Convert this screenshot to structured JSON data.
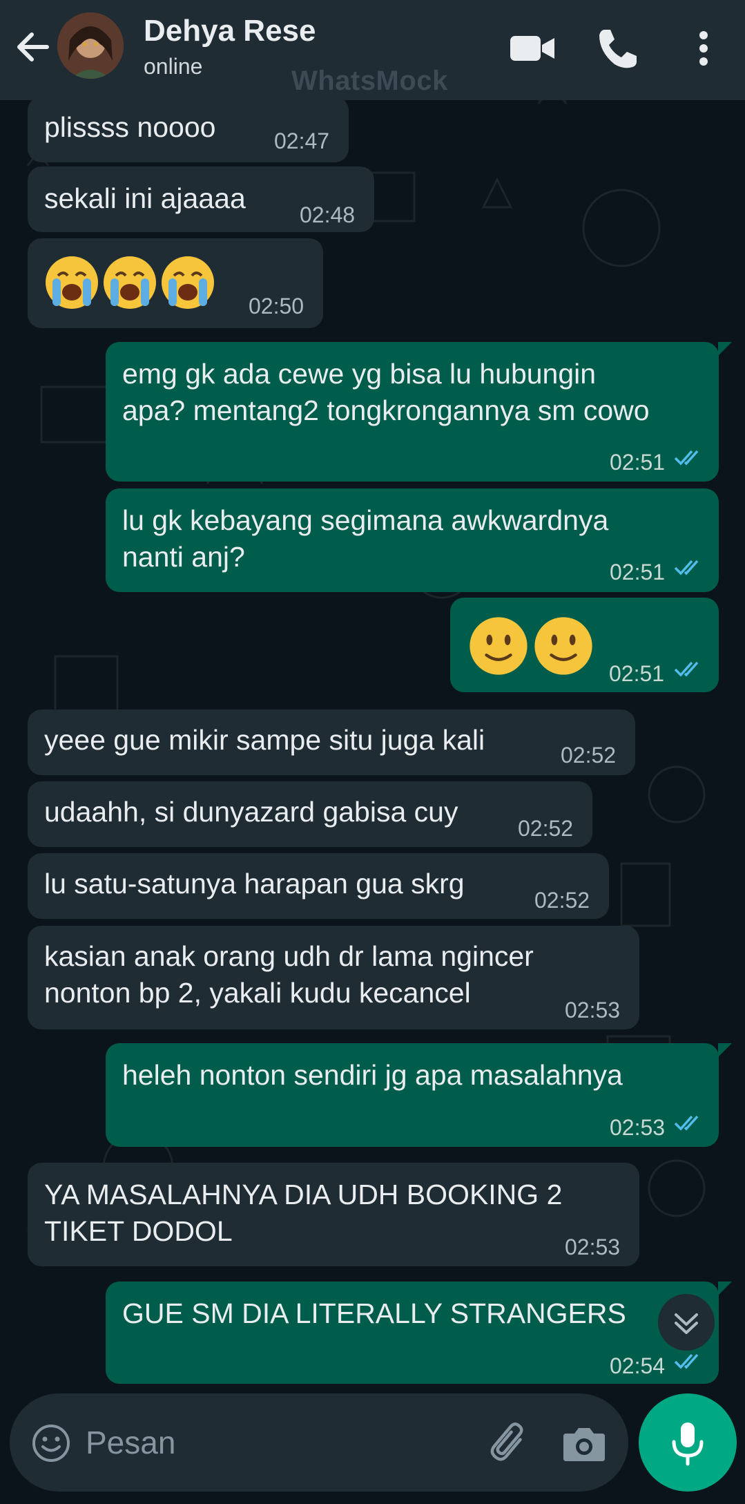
{
  "header": {
    "name": "Dehya Rese",
    "status": "online",
    "watermark": "WhatsMock"
  },
  "messages": [
    {
      "dir": "in",
      "text": "plissss noooo",
      "time": "02:47"
    },
    {
      "dir": "in",
      "text": "sekali ini ajaaaa",
      "time": "02:48"
    },
    {
      "dir": "in",
      "emoji": [
        "loudly-crying-face",
        "loudly-crying-face",
        "loudly-crying-face"
      ],
      "time": "02:50"
    },
    {
      "dir": "out",
      "text": "emg gk ada cewe yg bisa lu hubungin\napa? mentang2 tongkrongannya sm cowo",
      "time": "02:51",
      "status": "read"
    },
    {
      "dir": "out",
      "text": "lu gk kebayang segimana awkwardnya\nnanti anj?",
      "time": "02:51",
      "status": "read"
    },
    {
      "dir": "out",
      "emoji": [
        "slightly-smiling-face",
        "slightly-smiling-face"
      ],
      "time": "02:51",
      "status": "read"
    },
    {
      "dir": "in",
      "text": "yeee gue mikir sampe situ juga kali",
      "time": "02:52"
    },
    {
      "dir": "in",
      "text": "udaahh, si dunyazard gabisa cuy",
      "time": "02:52"
    },
    {
      "dir": "in",
      "text": "lu satu-satunya harapan gua skrg",
      "time": "02:52"
    },
    {
      "dir": "in",
      "text": "kasian anak orang udh dr lama ngincer\nnonton bp 2, yakali kudu kecancel",
      "time": "02:53"
    },
    {
      "dir": "out",
      "text": "heleh nonton sendiri jg apa masalahnya",
      "time": "02:53",
      "status": "read"
    },
    {
      "dir": "in",
      "text": "YA MASALAHNYA DIA UDH BOOKING 2\nTIKET DODOL",
      "time": "02:53"
    },
    {
      "dir": "out",
      "text": "GUE SM DIA LITERALLY STRANGERS",
      "time": "02:54",
      "status": "read"
    }
  ],
  "composer": {
    "placeholder": "Pesan"
  },
  "colors": {
    "header_bg": "#1f2c34",
    "chat_bg": "#0b141a",
    "incoming_bubble": "#1f2c34",
    "outgoing_bubble": "#005c4b",
    "read_tick": "#53bdeb",
    "accent": "#00a884"
  },
  "icons": {
    "back": "arrow-left-icon",
    "video": "video-call-icon",
    "call": "phone-icon",
    "menu": "more-vertical-icon",
    "emoji": "emoji-smile-icon",
    "attach": "paperclip-icon",
    "camera": "camera-icon",
    "mic": "microphone-icon",
    "scroll": "chevron-double-down-icon"
  }
}
